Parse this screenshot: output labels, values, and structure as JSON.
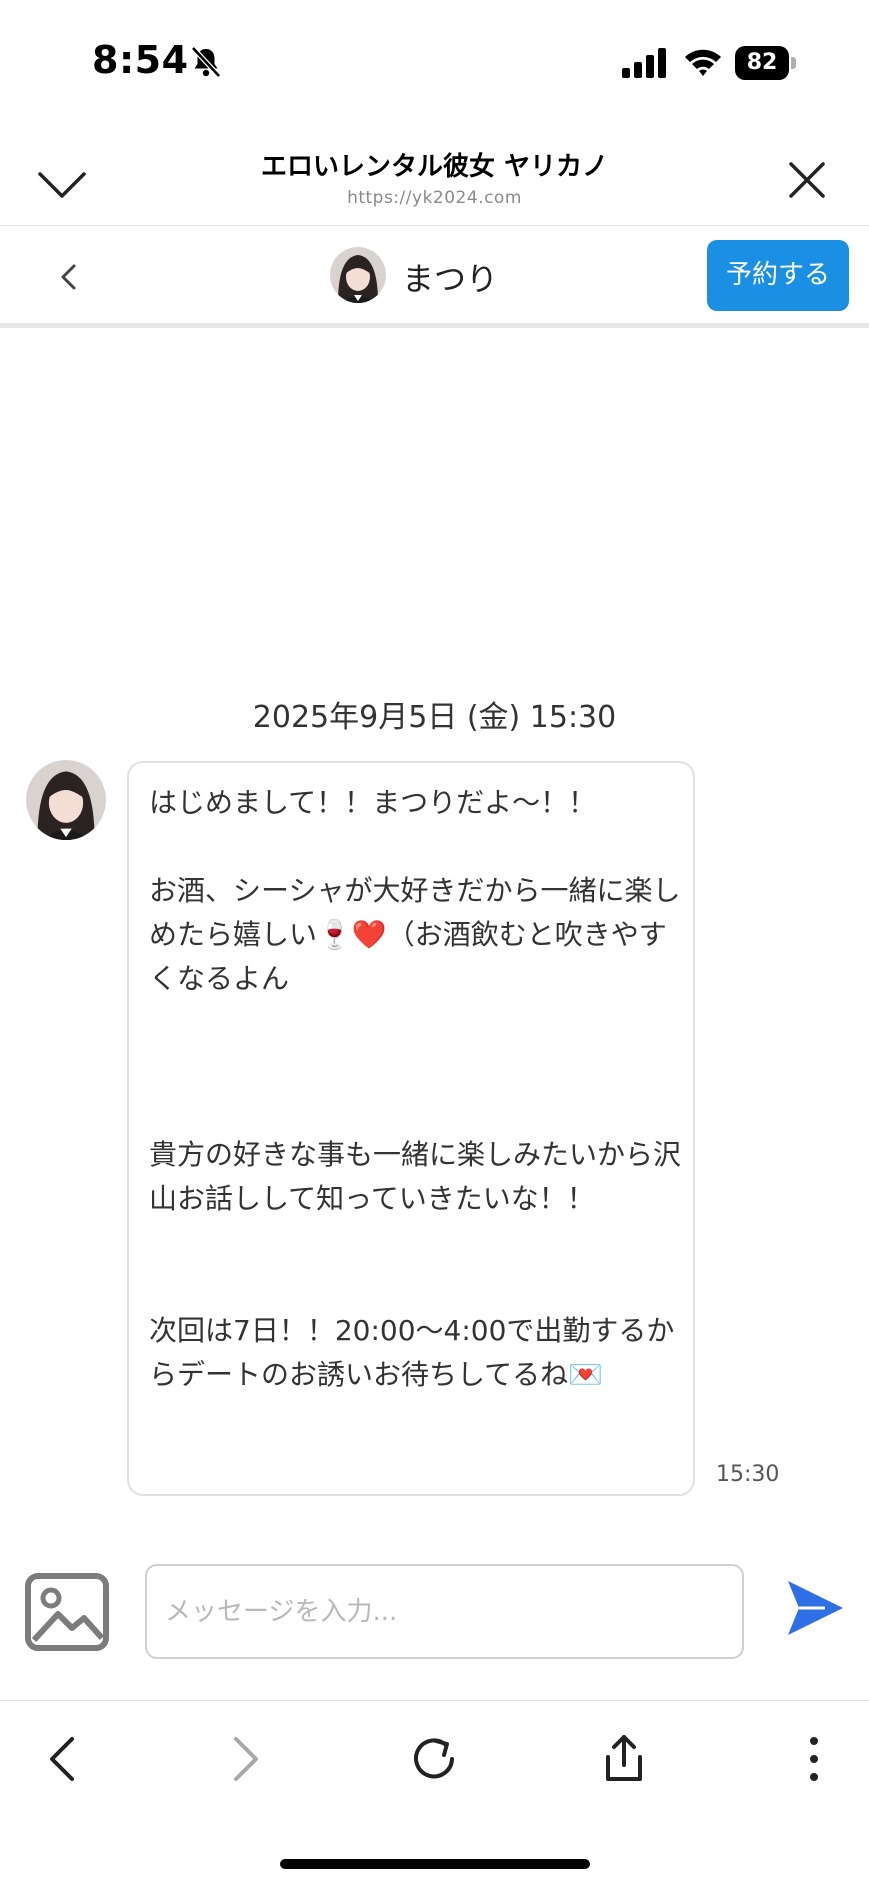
{
  "status_bar": {
    "time": "8:54",
    "battery": "82",
    "icons": [
      "bell-off-icon",
      "signal-icon",
      "wifi-icon",
      "battery-icon"
    ]
  },
  "browser": {
    "title": "エロいレンタル彼女 ヤリカノ",
    "url": "https://yk2024.com",
    "icons": [
      "chevron-down-icon",
      "close-icon"
    ]
  },
  "chat_header": {
    "contact_name": "まつり",
    "reserve_label": "予約する",
    "colors": {
      "accent": "#1a8fe3"
    }
  },
  "conversation": {
    "date_stamp": "2025年9月5日 (金) 15:30",
    "messages": [
      {
        "sender": "まつり",
        "text": "はじめまして！！まつりだよ〜！！\n\nお酒、シーシャが大好きだから一緒に楽しめたら嬉しい🍷❤️（お酒飲むと吹きやすくなるよん\n\n\n\n貴方の好きな事も一緒に楽しみたいから沢山お話しして知っていきたいな！！\n\n\n次回は7日！！20:00〜4:00で出勤するからデートのお誘いお待ちしてるね💌",
        "time": "15:30"
      }
    ]
  },
  "composer": {
    "placeholder": "メッセージを入力...",
    "value": "",
    "icons": [
      "image-icon",
      "send-icon"
    ],
    "send_color": "#2f6fe4"
  },
  "toolbar": {
    "icons": [
      "back-arrow-icon",
      "forward-arrow-icon",
      "reload-icon",
      "share-icon",
      "more-vertical-icon"
    ]
  }
}
